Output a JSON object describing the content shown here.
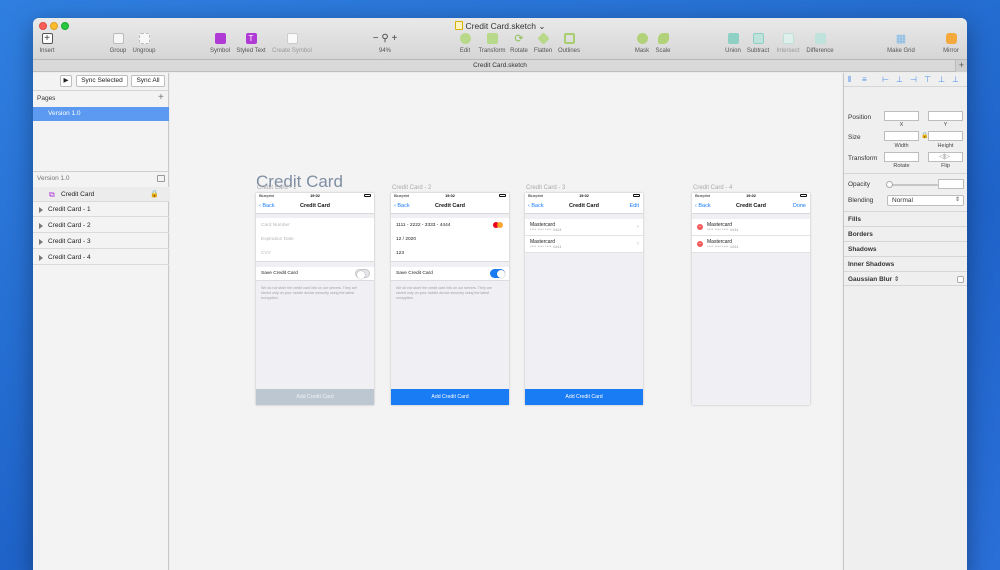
{
  "window": {
    "doc_title": "Credit Card.sketch",
    "tab_label": "Credit Card.sketch"
  },
  "toolbar": {
    "insert": "Insert",
    "group": "Group",
    "ungroup": "Ungroup",
    "symbol": "Symbol",
    "styled_text": "Styled Text",
    "create_symbol": "Create Symbol",
    "zoom_value": "94%",
    "zoom_minus": "−",
    "zoom_plus": "+",
    "edit": "Edit",
    "transform": "Transform",
    "rotate": "Rotate",
    "flatten": "Flatten",
    "outlines": "Outlines",
    "mask": "Mask",
    "scale": "Scale",
    "union": "Union",
    "subtract": "Subtract",
    "intersect": "Intersect",
    "difference": "Difference",
    "make_grid": "Make Grid",
    "mirror": "Mirror"
  },
  "left": {
    "sync_selected": "Sync Selected",
    "sync_all": "Sync All",
    "pages_label": "Pages",
    "selected_page": "Version 1.0",
    "layers_header": "Version 1.0",
    "layers": [
      "Credit Card",
      "Credit Card - 1",
      "Credit Card - 2",
      "Credit Card - 3",
      "Credit Card - 4"
    ]
  },
  "canvas": {
    "title": "Credit Card",
    "artboards": [
      {
        "label": "Credit Card - 1",
        "status_left": "Blueprint",
        "status_time": "19:02",
        "back": "Back",
        "nav_title": "Credit Card",
        "nav_action": "",
        "fields": [
          "Card Number",
          "Expiration Date",
          "CVV"
        ],
        "save_label": "Save Credit Card",
        "note": "We do not store the credit card info on our servers. They are stored only on your mobile device securely using the latest encryption.",
        "button": "Add Credit Card"
      },
      {
        "label": "Credit Card - 2",
        "status_left": "Blueprint",
        "status_time": "19:02",
        "back": "Back",
        "nav_title": "Credit Card",
        "nav_action": "",
        "fields": [
          "1111 - 2222 - 3333 - 4444",
          "12 / 2020",
          "123"
        ],
        "save_label": "Save Credit Card",
        "note": "We do not store the credit card info on our servers. They are stored only on your mobile device securely using the latest encryption.",
        "button": "Add Credit Card"
      },
      {
        "label": "Credit Card - 3",
        "status_left": "Blueprint",
        "status_time": "19:02",
        "back": "Back",
        "nav_title": "Credit Card",
        "nav_action": "Edit",
        "cards": [
          {
            "name": "Mastercard",
            "number": "**** **** **** 4444"
          },
          {
            "name": "Mastercard",
            "number": "**** **** **** 4444"
          }
        ],
        "button": "Add Credit Card"
      },
      {
        "label": "Credit Card - 4",
        "status_left": "Blueprint",
        "status_time": "19:02",
        "back": "Back",
        "nav_title": "Credit Card",
        "nav_action": "Done",
        "cards": [
          {
            "name": "Mastercard",
            "number": "**** **** **** 4444"
          },
          {
            "name": "Mastercard",
            "number": "**** **** **** 4444"
          }
        ]
      }
    ]
  },
  "inspector": {
    "position": "Position",
    "x": "X",
    "y": "Y",
    "size": "Size",
    "width": "Width",
    "height": "Height",
    "transform": "Transform",
    "rotate": "Rotate",
    "flip": "Flip",
    "opacity": "Opacity",
    "blending": "Blending",
    "blending_value": "Normal",
    "fills": "Fills",
    "borders": "Borders",
    "shadows": "Shadows",
    "inner_shadows": "Inner Shadows",
    "gaussian_blur": "Gaussian Blur"
  },
  "colors": {
    "accent": "#1a7cf5",
    "selection": "#5b9af0",
    "disabled_button": "#bdc7d2"
  }
}
